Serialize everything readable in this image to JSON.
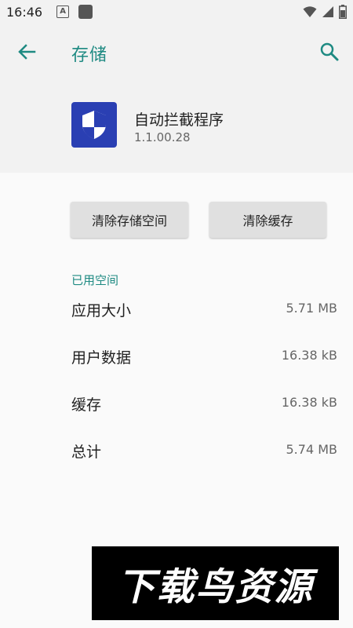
{
  "status_bar": {
    "time": "16:46",
    "indicator_a": "A",
    "icons": [
      "a-notification-icon",
      "app-notification-icon",
      "wifi-icon",
      "signal-icon",
      "battery-icon"
    ]
  },
  "app_bar": {
    "title": "存储",
    "accent_color": "#1e8a82"
  },
  "app_info": {
    "name": "自动拦截程序",
    "version": "1.1.00.28",
    "icon": "shield-icon",
    "icon_bg": "#2a3fb3"
  },
  "actions": {
    "clear_storage": "清除存储空间",
    "clear_cache": "清除缓存"
  },
  "storage": {
    "section_title": "已用空间",
    "rows": [
      {
        "label": "应用大小",
        "value": "5.71 MB"
      },
      {
        "label": "用户数据",
        "value": "16.38 kB"
      },
      {
        "label": "缓存",
        "value": "16.38 kB"
      },
      {
        "label": "总计",
        "value": "5.74 MB"
      }
    ]
  },
  "watermark": {
    "text": "下载鸟资源"
  }
}
